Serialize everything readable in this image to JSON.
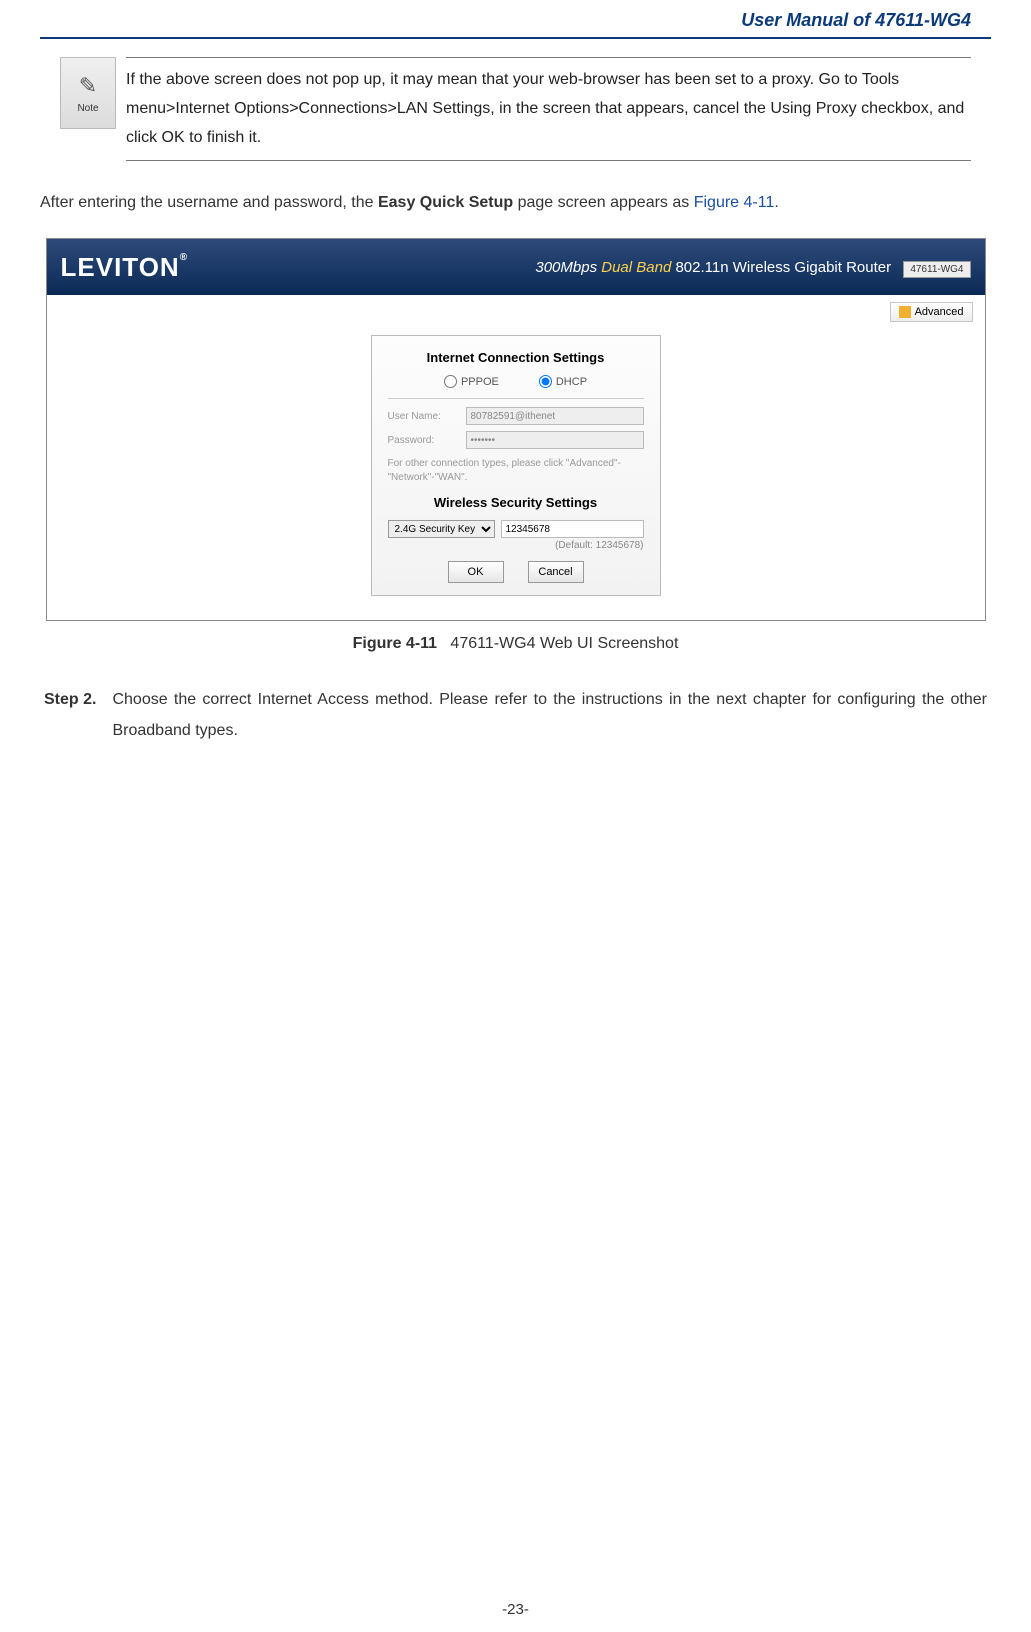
{
  "header": {
    "title": "User Manual of 47611-WG4"
  },
  "note": {
    "icon_label": "Note",
    "text": "If the above screen does not pop up, it may mean that your web-browser has been set to a proxy. Go to Tools menu>Internet Options>Connections>LAN Settings, in the screen that appears, cancel the Using Proxy checkbox, and click OK to finish it."
  },
  "intro": {
    "prefix": "After entering the username and password, the ",
    "bold": "Easy Quick Setup",
    "mid": " page screen appears as ",
    "figref": "Figure 4-11",
    "suffix": "."
  },
  "screenshot": {
    "brand": "LEVITON",
    "banner_speed": "300Mbps ",
    "banner_dual": "Dual Band",
    "banner_rest": " 802.11n Wireless Gigabit Router",
    "model_chip": "47611-WG4",
    "advanced_btn": "Advanced",
    "dialog": {
      "heading1": "Internet Connection Settings",
      "radio_pppoe": "PPPOE",
      "radio_dhcp": "DHCP",
      "user_label": "User Name:",
      "user_value": "80782591@ithenet",
      "pass_label": "Password:",
      "pass_value": "•••••••",
      "hint": "For other connection types, please click \"Advanced\"-\"Network\"-\"WAN\".",
      "heading2": "Wireless Security Settings",
      "sec_select": "2.4G Security Key",
      "sec_value": "12345678",
      "default_note": "(Default: 12345678)",
      "ok": "OK",
      "cancel": "Cancel"
    }
  },
  "caption": {
    "fig": "Figure 4-11",
    "text": "47611-WG4 Web UI Screenshot"
  },
  "step": {
    "label": "Step 2.",
    "text": "Choose the correct Internet Access method. Please refer to the instructions in the next chapter for configuring the other Broadband types."
  },
  "footer": {
    "page": "-23-"
  }
}
